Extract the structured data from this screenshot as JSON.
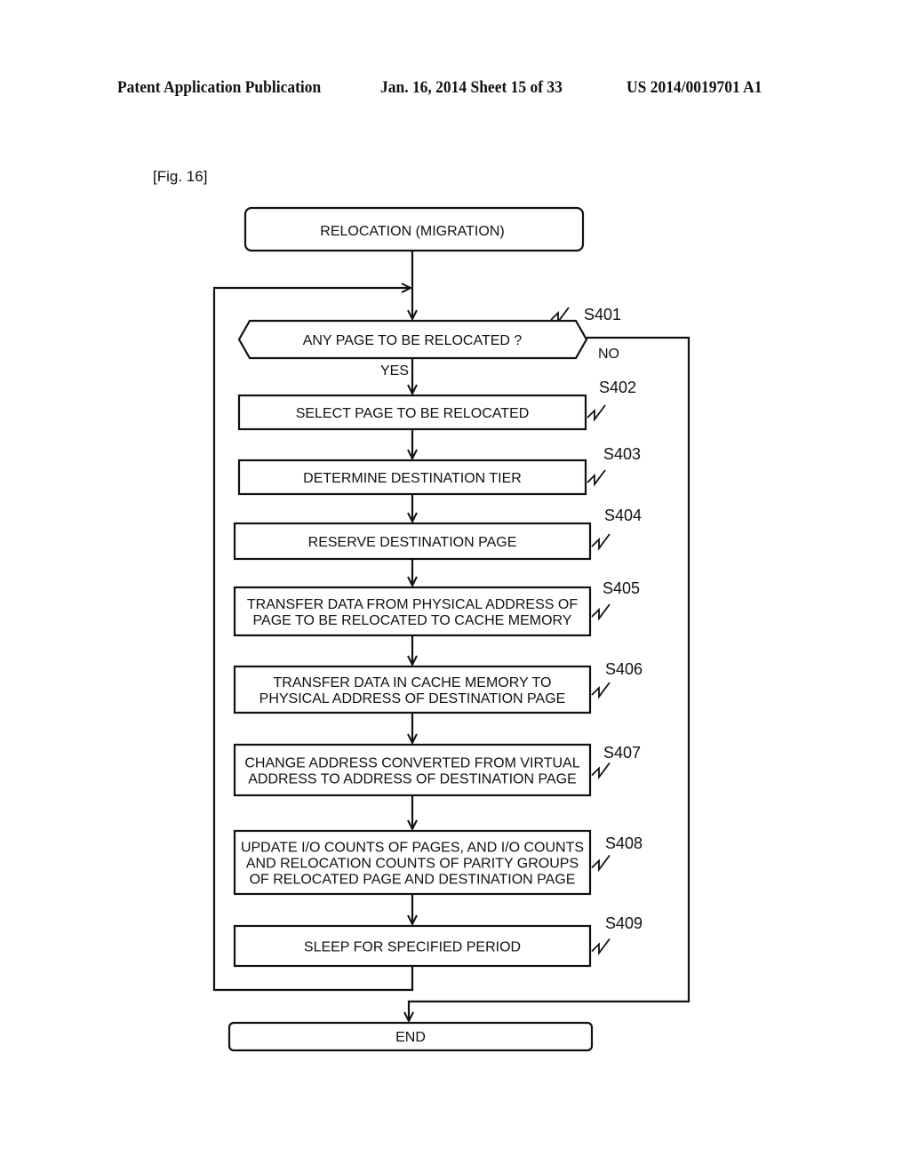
{
  "header": {
    "publication": "Patent Application Publication",
    "date_sheet": "Jan. 16, 2014  Sheet 15 of 33",
    "patent_number": "US 2014/0019701 A1"
  },
  "figure": {
    "label": "[Fig. 16]",
    "start": "RELOCATION (MIGRATION)",
    "decision": {
      "id": "S401",
      "text": "ANY PAGE TO BE RELOCATED ?",
      "yes_label": "YES",
      "no_label": "NO"
    },
    "steps": [
      {
        "id": "S402",
        "lines": [
          "SELECT PAGE TO BE RELOCATED"
        ]
      },
      {
        "id": "S403",
        "lines": [
          "DETERMINE DESTINATION TIER"
        ]
      },
      {
        "id": "S404",
        "lines": [
          "RESERVE DESTINATION PAGE"
        ]
      },
      {
        "id": "S405",
        "lines": [
          "TRANSFER DATA FROM PHYSICAL ADDRESS OF",
          "PAGE TO BE RELOCATED TO CACHE MEMORY"
        ]
      },
      {
        "id": "S406",
        "lines": [
          "TRANSFER DATA IN CACHE MEMORY TO",
          "PHYSICAL ADDRESS OF DESTINATION PAGE"
        ]
      },
      {
        "id": "S407",
        "lines": [
          "CHANGE ADDRESS CONVERTED FROM VIRTUAL",
          "ADDRESS TO ADDRESS OF DESTINATION PAGE"
        ]
      },
      {
        "id": "S408",
        "lines": [
          "UPDATE I/O COUNTS OF PAGES, AND I/O COUNTS",
          "AND RELOCATION COUNTS OF PARITY GROUPS",
          "OF RELOCATED PAGE AND DESTINATION PAGE"
        ]
      },
      {
        "id": "S409",
        "lines": [
          "SLEEP FOR SPECIFIED PERIOD"
        ]
      }
    ],
    "end": "END"
  }
}
